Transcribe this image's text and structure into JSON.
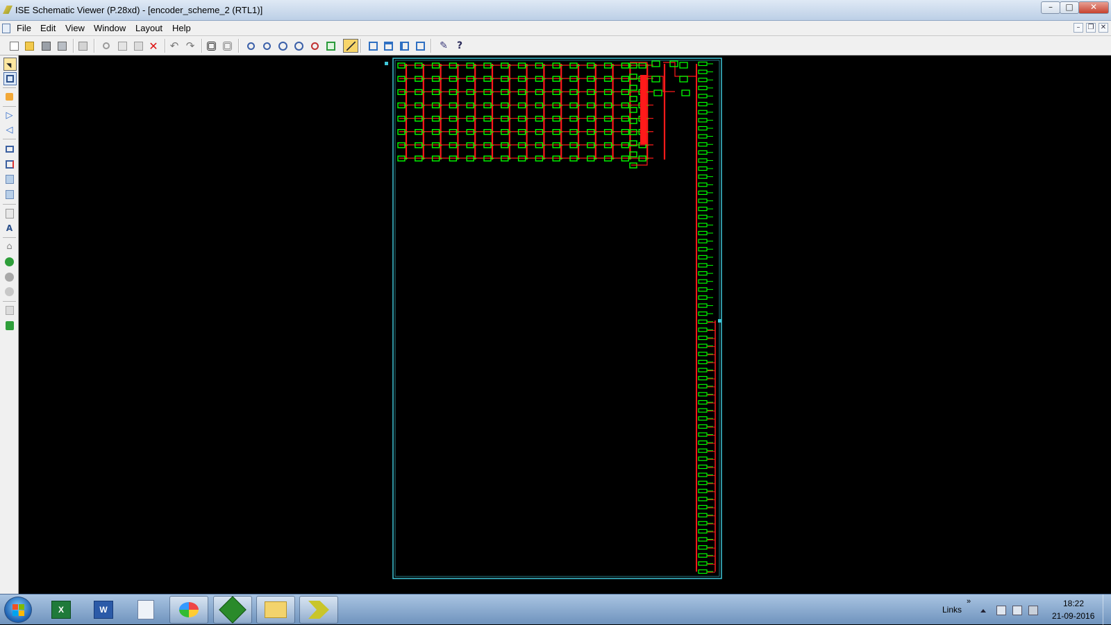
{
  "window": {
    "title": "ISE Schematic Viewer (P.28xd) - [encoder_scheme_2 (RTL1)]",
    "controls": {
      "minimize": "–",
      "maximize": "□",
      "close": "✕"
    }
  },
  "menubar": {
    "items": [
      "File",
      "Edit",
      "View",
      "Window",
      "Layout",
      "Help"
    ],
    "mdi_controls": {
      "minimize": "–",
      "restore": "❐",
      "close": "✕"
    }
  },
  "toolbar": {
    "groups": [
      [
        "new-file-icon",
        "open-folder-icon",
        "save-icon",
        "save-all-icon"
      ],
      [
        "print-icon"
      ],
      [
        "cut-icon",
        "copy-icon",
        "paste-icon",
        "delete-icon"
      ],
      [
        "undo-icon",
        "redo-icon"
      ],
      [
        "find-icon",
        "find-clear-icon"
      ],
      [
        "zoom-in-icon",
        "zoom-out-icon",
        "zoom-full-icon",
        "zoom-area-icon",
        "zoom-select-icon",
        "refresh-icon",
        "highlight-icon"
      ],
      [
        "cascade-icon",
        "tile-horizontal-icon",
        "tile-vertical-icon",
        "arrange-icon"
      ],
      [
        "settings-icon",
        "help-context-icon"
      ]
    ]
  },
  "left_toolbar": {
    "tools": [
      "select-icon",
      "net-select-icon",
      "pin-icon",
      "add-input-icon",
      "add-output-icon",
      "push-icon",
      "pop-icon",
      "expand-icon",
      "collapse-icon",
      "text-icon",
      "label-icon",
      "home-icon",
      "back-icon",
      "forward-icon",
      "history-icon",
      "properties-icon",
      "go-icon"
    ]
  },
  "schematic": {
    "document": "encoder_scheme_2 (RTL1)",
    "colors": {
      "background": "#000000",
      "frame": "#3fc6d8",
      "instance": "#00ff00",
      "net": "#ff1a1a"
    },
    "logic_grid": {
      "columns": 15,
      "rows": 8
    },
    "output_column_rows": 64
  },
  "taskbar": {
    "apps": [
      "excel-icon",
      "word-icon",
      "text-editor-icon",
      "paint-icon",
      "vim-icon",
      "file-explorer-icon",
      "ise-icon"
    ],
    "links_label": "Links",
    "chevron": "»",
    "time": "18:22",
    "date": "21-09-2016",
    "colors": {
      "taskbar": "#7ea0c8"
    }
  }
}
